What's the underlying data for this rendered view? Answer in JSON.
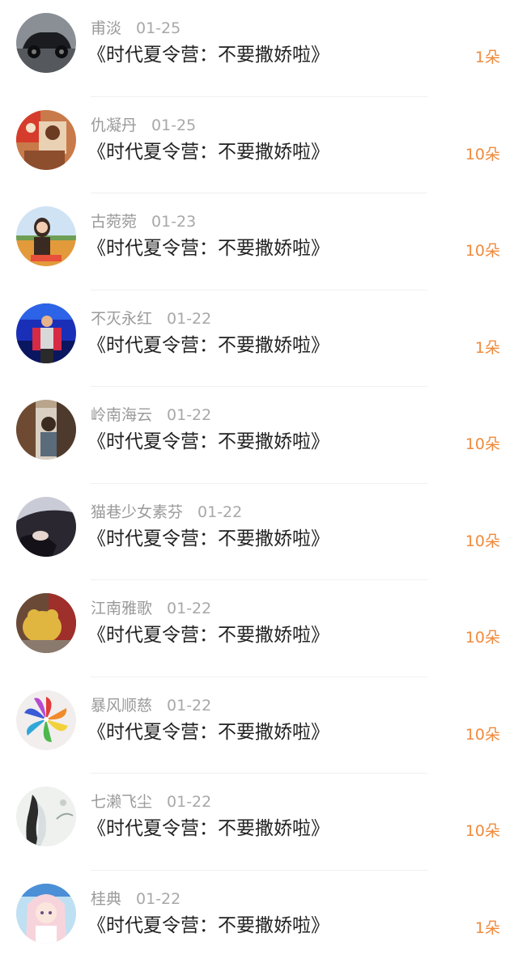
{
  "gifts": [
    {
      "name": "甫淡",
      "date": "01-25",
      "title": "《时代夏令营：不要撒娇啦》",
      "count": "1朵",
      "avatar": "car"
    },
    {
      "name": "仇凝丹",
      "date": "01-25",
      "title": "《时代夏令营：不要撒娇啦》",
      "count": "10朵",
      "avatar": "poster"
    },
    {
      "name": "古菀菀",
      "date": "01-23",
      "title": "《时代夏令营：不要撒娇啦》",
      "count": "10朵",
      "avatar": "girl-field"
    },
    {
      "name": "不灭永红",
      "date": "01-22",
      "title": "《时代夏令营：不要撒娇啦》",
      "count": "1朵",
      "avatar": "stage"
    },
    {
      "name": "岭南海云",
      "date": "01-22",
      "title": "《时代夏令营：不要撒娇啦》",
      "count": "10朵",
      "avatar": "door"
    },
    {
      "name": "猫巷少女素芬",
      "date": "01-22",
      "title": "《时代夏令营：不要撒娇啦》",
      "count": "10朵",
      "avatar": "hair"
    },
    {
      "name": "江南雅歌",
      "date": "01-22",
      "title": "《时代夏令营：不要撒娇啦》",
      "count": "10朵",
      "avatar": "bear"
    },
    {
      "name": "暴风顺慈",
      "date": "01-22",
      "title": "《时代夏令营：不要撒娇啦》",
      "count": "10朵",
      "avatar": "pinwheel"
    },
    {
      "name": "七濑飞尘",
      "date": "01-22",
      "title": "《时代夏令营：不要撒娇啦》",
      "count": "10朵",
      "avatar": "ink"
    },
    {
      "name": "桂典",
      "date": "01-22",
      "title": "《时代夏令营：不要撒娇啦》",
      "count": "1朵",
      "avatar": "anime"
    }
  ],
  "colors": {
    "count": "#f08a3c",
    "title": "#222222",
    "meta": "#9a9a9a"
  }
}
